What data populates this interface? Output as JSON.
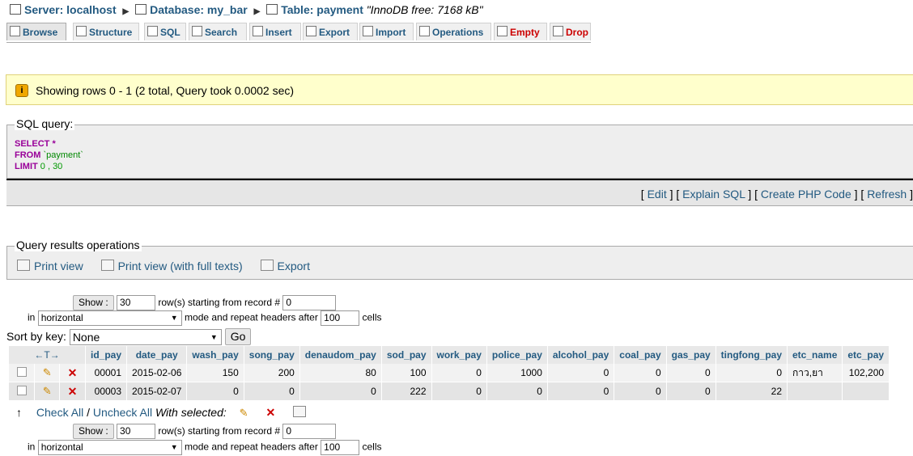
{
  "breadcrumb": {
    "server_label": "Server: localhost",
    "database_label": "Database: my_bar",
    "table_label": "Table: payment",
    "table_note": "\"InnoDB free: 7168 kB\""
  },
  "tabs": [
    {
      "label": "Browse",
      "icon": "browse-icon"
    },
    {
      "label": "Structure",
      "icon": "structure-icon"
    },
    {
      "label": "SQL",
      "icon": "sql-icon"
    },
    {
      "label": "Search",
      "icon": "search-icon"
    },
    {
      "label": "Insert",
      "icon": "insert-icon"
    },
    {
      "label": "Export",
      "icon": "export-icon"
    },
    {
      "label": "Import",
      "icon": "import-icon"
    },
    {
      "label": "Operations",
      "icon": "operations-icon"
    },
    {
      "label": "Empty",
      "icon": "empty-icon"
    },
    {
      "label": "Drop",
      "icon": "drop-icon"
    }
  ],
  "message": {
    "text": "Showing rows 0 - 1 (2 total, Query took 0.0002 sec)",
    "icon_glyph": "i"
  },
  "sql_box": {
    "legend": "SQL query:",
    "kw_select": "SELECT",
    "star": "*",
    "kw_from": "FROM",
    "table": "`payment`",
    "kw_limit": "LIMIT",
    "limit_vals": "0 , 30"
  },
  "sql_links": {
    "edit": "Edit",
    "explain": "Explain SQL",
    "php": "Create PHP Code",
    "refresh": "Refresh"
  },
  "query_ops": {
    "legend": "Query results operations",
    "print_view": "Print view",
    "print_full": "Print view (with full texts)",
    "export": "Export"
  },
  "nav": {
    "show_label": "Show :",
    "rows_value": "30",
    "starting_text": "row(s) starting from record #",
    "record_value": "0",
    "in_label": "in",
    "mode_value": "horizontal",
    "mode_text": "mode and repeat headers after",
    "headers_value": "100",
    "cells_text": "cells"
  },
  "sort": {
    "label": "Sort by key:",
    "value": "None",
    "go": "Go"
  },
  "table": {
    "arrows": "←T→",
    "columns": [
      "id_pay",
      "date_pay",
      "wash_pay",
      "song_pay",
      "denaudom_pay",
      "sod_pay",
      "work_pay",
      "police_pay",
      "alcohol_pay",
      "coal_pay",
      "gas_pay",
      "tingfong_pay",
      "etc_name",
      "etc_pay"
    ],
    "rows": [
      [
        "00001",
        "2015-02-06",
        "150",
        "200",
        "80",
        "100",
        "0",
        "1000",
        "0",
        "0",
        "0",
        "0",
        "กาว,ยา",
        "102,200"
      ],
      [
        "00003",
        "2015-02-07",
        "0",
        "0",
        "0",
        "222",
        "0",
        "0",
        "0",
        "0",
        "0",
        "22",
        "",
        ""
      ]
    ]
  },
  "check": {
    "check_all": "Check All",
    "slash": "/",
    "uncheck_all": "Uncheck All",
    "with_selected": "With selected:"
  }
}
